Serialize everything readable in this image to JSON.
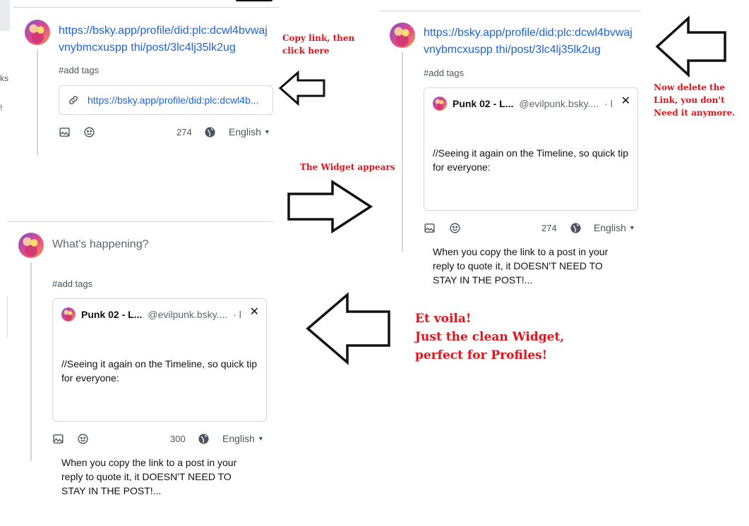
{
  "panel_copy": {
    "link_text": "https://bsky.app/profile/did:plc:dcwl4bvwaj vnybmcxuspp thi/post/3lc4lj35lk2ug",
    "tags": "#add tags",
    "link_card_url": "https://bsky.app/profile/did:plc:dcwl4b...",
    "count": "274",
    "language": "English"
  },
  "panel_widget": {
    "link_text": "https://bsky.app/profile/did:plc:dcwl4bvwaj vnybmcxuspp thi/post/3lc4lj35lk2ug",
    "tags": "#add tags",
    "count": "274",
    "language": "English"
  },
  "panel_final": {
    "placeholder": "What's happening?",
    "tags": "#add tags",
    "count": "300",
    "language": "English"
  },
  "quote_card": {
    "name": "Punk 02 - L...",
    "handle": "@evilpunk.bsky....",
    "dot": "· l",
    "close": "✕",
    "body_line1": "//Seeing it again on the Timeline, so quick tip for everyone:",
    "body_line2": "When you copy the link to a post in your reply to quote it, it DOESN'T NEED TO STAY IN THE POST!..."
  },
  "annotations": {
    "copy_link": "Copy link, then click here",
    "widget_appears": "The Widget appears",
    "delete_link": "Now delete the Link, you  don't Need it anymore.",
    "voila_1": "Et voila!",
    "voila_2": "Just the clean Widget,",
    "voila_3": "perfect for Profiles!"
  },
  "edge_fragments": {
    "a": "ks",
    "b": "!"
  },
  "colors": {
    "link": "#1d62d6",
    "annotation": "#e0131a",
    "border": "#d4d8dc"
  },
  "icons": [
    "image-icon",
    "emoji-icon",
    "globe-icon",
    "link-icon",
    "chevron-down-icon",
    "close-icon",
    "arrow-left-icon",
    "arrow-right-icon"
  ]
}
